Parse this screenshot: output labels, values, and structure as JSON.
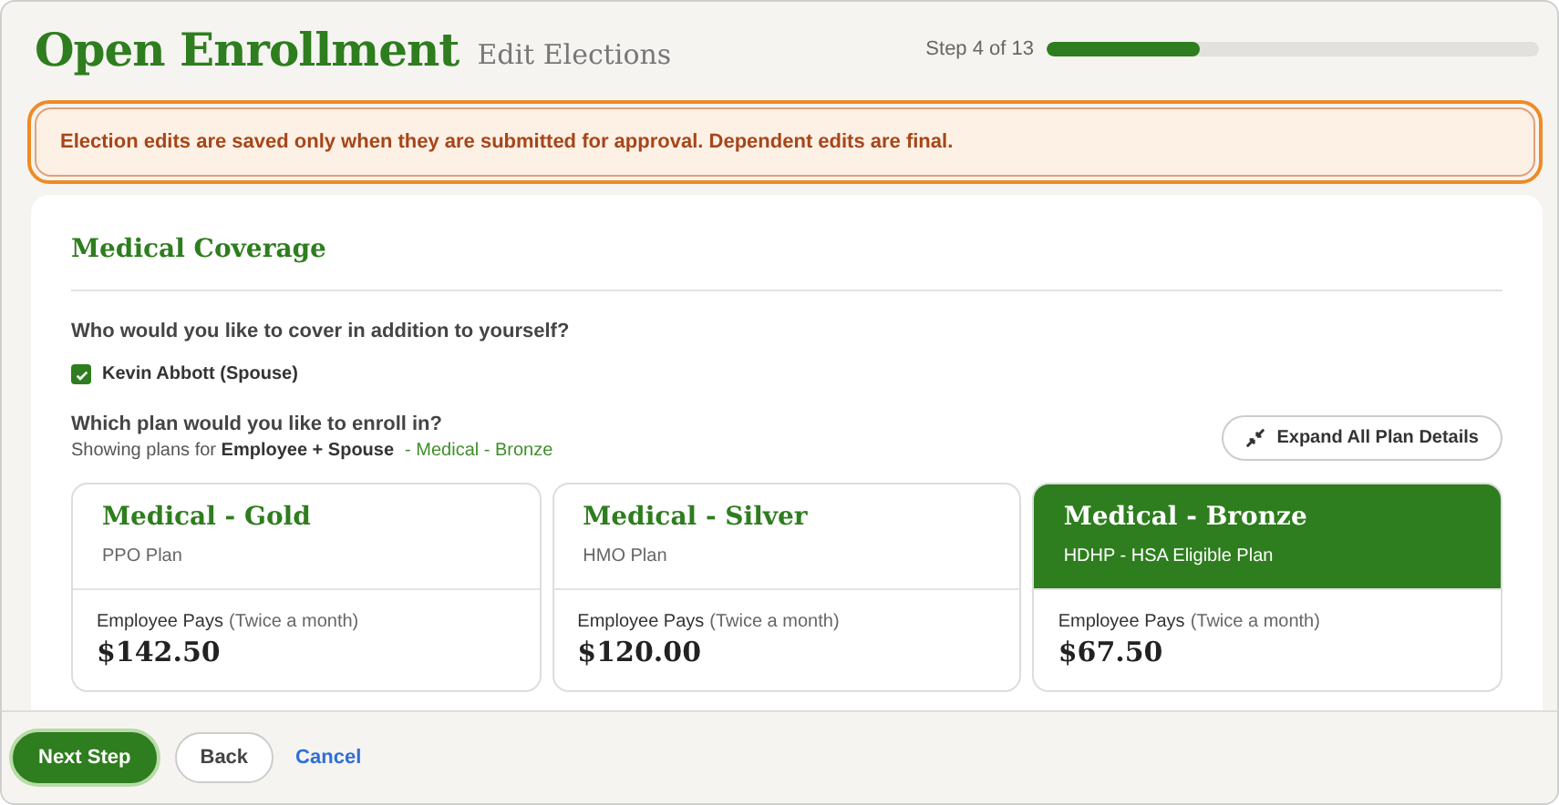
{
  "header": {
    "title": "Open Enrollment",
    "subtitle": "Edit Elections",
    "step": "Step 4 of 13",
    "progress": {
      "level": 0.31
    }
  },
  "alert": {
    "message": "Election edits are saved only when they are submitted for approval. Dependent edits are final.",
    "focused": true
  },
  "section": {
    "title": "Medical Coverage",
    "dependents_question": "Who would you like to cover in addition to yourself?",
    "dependents": [
      {
        "label": "Kevin Abbott (Spouse)",
        "checked": true
      }
    ],
    "plan_question": "Which plan would you like to enroll in?",
    "plan_filter": "Showing plans for **Employee + Spouse**",
    "plan_note": "- Medical - Bronze",
    "expand_button": "Expand All Plan Details",
    "plans": [
      {
        "name": "Medical - Gold",
        "type": "PPO Plan",
        "pays_label": "Employee Pays",
        "frequency": "(Twice a month)",
        "price": "$142.50",
        "selected": false
      },
      {
        "name": "Medical - Silver",
        "type": "HMO Plan",
        "pays_label": "Employee Pays",
        "frequency": "(Twice a month)",
        "price": "$120.00",
        "selected": false
      },
      {
        "name": "Medical - Bronze",
        "type": "HDHP - HSA Eligible Plan",
        "pays_label": "Employee Pays",
        "frequency": "(Twice a month)",
        "price": "$67.50",
        "selected": true
      }
    ]
  },
  "footer": {
    "buttons": [
      {
        "label": "Next Step",
        "kind": "primary"
      },
      {
        "label": "Back",
        "kind": "secondary"
      },
      {
        "label": "Cancel",
        "kind": "link"
      }
    ]
  }
}
